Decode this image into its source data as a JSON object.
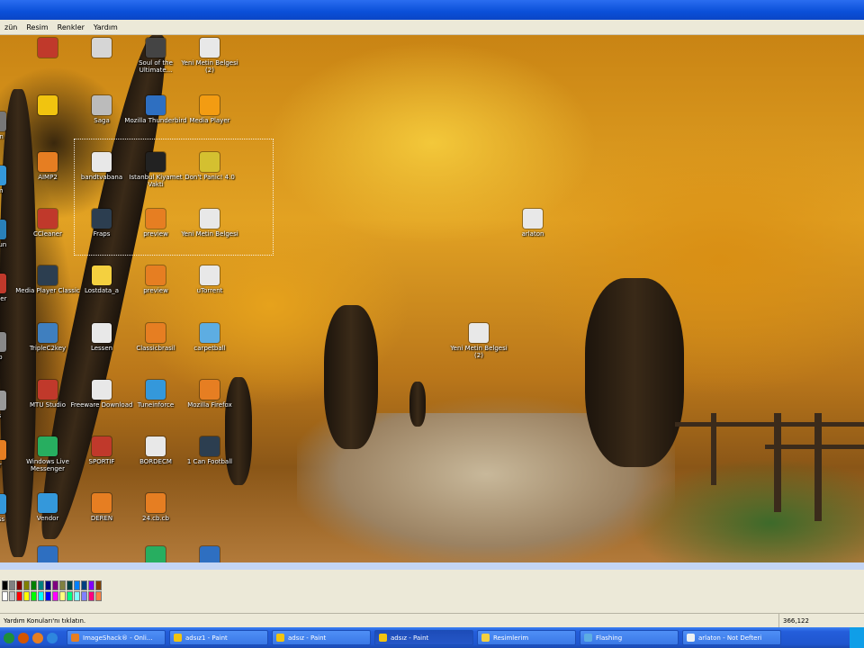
{
  "menubar": {
    "items": [
      "zün",
      "Resim",
      "Renkler",
      "Yardım"
    ]
  },
  "desktop_icons": [
    {
      "label": "",
      "color": "#c0392b",
      "icon": "app-icon"
    },
    {
      "label": "",
      "color": "#d6d6d6",
      "icon": "app-icon"
    },
    {
      "label": "Soul of the Ultimate...",
      "color": "#444444",
      "icon": "game-icon"
    },
    {
      "label": "Yeni Metin Belgesi (2)",
      "color": "#e8e8e8",
      "icon": "text-document-icon"
    },
    {
      "label": "",
      "color": "#f1c40f",
      "icon": "app-icon"
    },
    {
      "label": "Saga",
      "color": "#bbbbbb",
      "icon": "game-icon"
    },
    {
      "label": "Mozilla Thunderbird",
      "color": "#2e6fc1",
      "icon": "thunderbird-icon"
    },
    {
      "label": "Media Player",
      "color": "#f39c12",
      "icon": "media-player-icon"
    },
    {
      "label": "AIMP2",
      "color": "#e67e22",
      "icon": "aimp-icon"
    },
    {
      "label": "bandtvabana",
      "color": "#e8e8e8",
      "icon": "text-document-icon"
    },
    {
      "label": "Istanbul Kiyamet Vakti",
      "color": "#222222",
      "icon": "game-icon"
    },
    {
      "label": "Don't Panic! 4.0",
      "color": "#d4c030",
      "icon": "app-icon"
    },
    {
      "label": "CCleaner",
      "color": "#c0392b",
      "icon": "ccleaner-icon"
    },
    {
      "label": "Fraps",
      "color": "#2c3e50",
      "icon": "fraps-icon"
    },
    {
      "label": "preview",
      "color": "#e67e22",
      "icon": "image-icon"
    },
    {
      "label": "Yeni Metin Belgesi",
      "color": "#e8e8e8",
      "icon": "text-document-icon"
    },
    {
      "label": "Media Player Classic",
      "color": "#2c3e50",
      "icon": "media-player-icon"
    },
    {
      "label": "Lostdata_a",
      "color": "#f4d03f",
      "icon": "folder-icon"
    },
    {
      "label": "preview",
      "color": "#e67e22",
      "icon": "image-icon"
    },
    {
      "label": "uTorrent",
      "color": "#e8e8e8",
      "icon": "text-document-icon"
    },
    {
      "label": "TripleC2key",
      "color": "#3f7fbf",
      "icon": "app-icon"
    },
    {
      "label": "Lessen",
      "color": "#e8e8e8",
      "icon": "text-document-icon"
    },
    {
      "label": "Classicbrasil",
      "color": "#e67e22",
      "icon": "image-icon"
    },
    {
      "label": "carpetball",
      "color": "#5dade2",
      "icon": "app-icon"
    },
    {
      "label": "MTU Studio",
      "color": "#c0392b",
      "icon": "app-icon"
    },
    {
      "label": "Freeware Download",
      "color": "#e8e8e8",
      "icon": "app-icon"
    },
    {
      "label": "Tuneinforce",
      "color": "#3498db",
      "icon": "image-icon"
    },
    {
      "label": "Mozilla Firefox",
      "color": "#e67e22",
      "icon": "firefox-icon"
    },
    {
      "label": "Windows Live Messenger",
      "color": "#27ae60",
      "icon": "messenger-icon"
    },
    {
      "label": "SPORTIF",
      "color": "#c0392b",
      "icon": "app-icon"
    },
    {
      "label": "BORDECM",
      "color": "#e8e8e8",
      "icon": "text-document-icon"
    },
    {
      "label": "1 Can Football",
      "color": "#2c3e50",
      "icon": "game-icon"
    },
    {
      "label": "Vendor",
      "color": "#3498db",
      "icon": "app-icon"
    },
    {
      "label": "DEREN",
      "color": "#e67e22",
      "icon": "image-icon"
    },
    {
      "label": "24.cb.cb",
      "color": "#e67e22",
      "icon": "image-icon"
    },
    {
      "label": "arlaton",
      "color": "#e8e8e8",
      "icon": "text-document-icon"
    },
    {
      "label": "Yeni Metin Belgesi (2)",
      "color": "#e8e8e8",
      "icon": "text-document-icon"
    }
  ],
  "left_edge_labels": [
    "aren",
    "ilem",
    "ssojun",
    "reader",
    "app",
    "fos",
    "yer",
    "iness"
  ],
  "palette": {
    "colors": [
      "#000000",
      "#808080",
      "#800000",
      "#808000",
      "#008000",
      "#008080",
      "#000080",
      "#800080",
      "#808040",
      "#004040",
      "#0080ff",
      "#004080",
      "#8000ff",
      "#804000",
      "#ffffff",
      "#c0c0c0",
      "#ff0000",
      "#ffff00",
      "#00ff00",
      "#00ffff",
      "#0000ff",
      "#ff00ff",
      "#ffff80",
      "#00ff80",
      "#80ffff",
      "#8080ff",
      "#ff0080",
      "#ff8040"
    ]
  },
  "statusbar": {
    "help_text": "Yardım Konuları'nı tıklatın.",
    "coords": "366,122"
  },
  "taskbar": {
    "quicklaunch_colors": [
      "#1e8f3a",
      "#d35400",
      "#e67e22",
      "#2e86de"
    ],
    "tasks": [
      {
        "label": "ImageShack® - Onli...",
        "active": false,
        "color": "#e67e22"
      },
      {
        "label": "adsız1 - Paint",
        "active": false,
        "color": "#f1c40f"
      },
      {
        "label": "adsız - Paint",
        "active": false,
        "color": "#f1c40f"
      },
      {
        "label": "adsız - Paint",
        "active": true,
        "color": "#f1c40f"
      },
      {
        "label": "Resimlerim",
        "active": false,
        "color": "#f4d03f"
      },
      {
        "label": "Flashing",
        "active": false,
        "color": "#5dade2"
      },
      {
        "label": "arlaton - Not Defteri",
        "active": false,
        "color": "#ecf0f1"
      }
    ]
  }
}
